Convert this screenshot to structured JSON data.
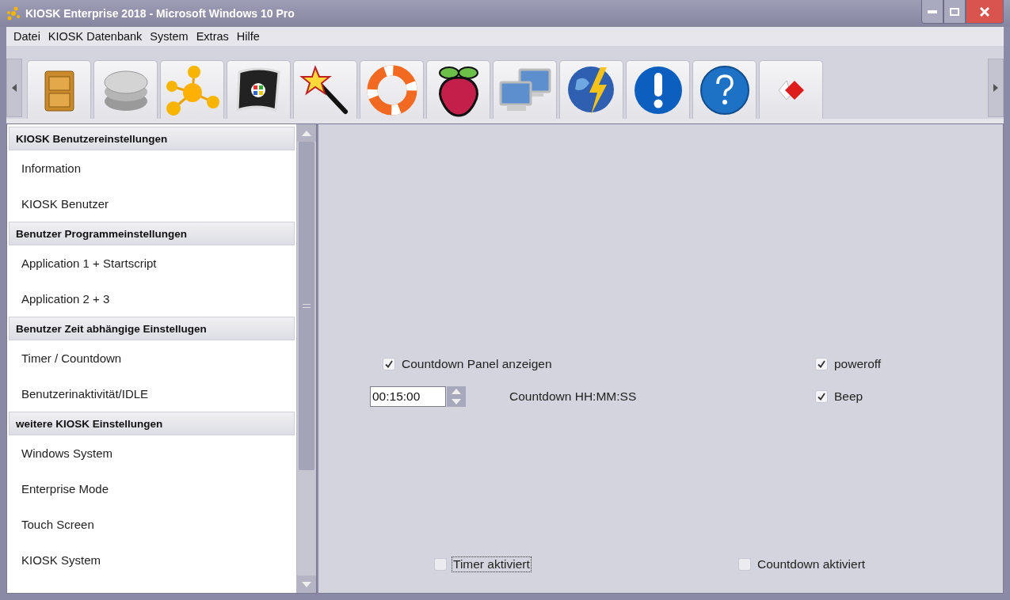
{
  "window": {
    "title": "KIOSK Enterprise 2018 - Microsoft Windows 10 Pro"
  },
  "menu": [
    "Datei",
    "KIOSK Datenbank",
    "System",
    "Extras",
    "Hilfe"
  ],
  "sidebar": {
    "groups": [
      {
        "title": "KIOSK Benutzereinstellungen",
        "items": [
          "Information",
          "KIOSK Benutzer"
        ]
      },
      {
        "title": "Benutzer Programmeinstellungen",
        "items": [
          "Application 1 + Startscript",
          "Application 2 + 3"
        ]
      },
      {
        "title": "Benutzer Zeit abhängige Einstellugen",
        "items": [
          "Timer / Countdown",
          "Benutzerinaktivität/IDLE"
        ]
      },
      {
        "title": "weitere KIOSK Einstellungen",
        "items": [
          "Windows System",
          "Enterprise Mode",
          "Touch Screen",
          "KIOSK System"
        ]
      }
    ]
  },
  "panel": {
    "show_panel": {
      "label": "Countdown Panel anzeigen",
      "checked": true
    },
    "poweroff": {
      "label": "poweroff",
      "checked": true
    },
    "countdown": {
      "value": "00:15:00",
      "label": "Countdown HH:MM:SS"
    },
    "beep": {
      "label": "Beep",
      "checked": true
    },
    "timer_active": {
      "label": "Timer aktiviert",
      "checked": false,
      "focused": true
    },
    "countdown_active": {
      "label": "Countdown aktiviert",
      "checked": false,
      "focused": false
    }
  }
}
